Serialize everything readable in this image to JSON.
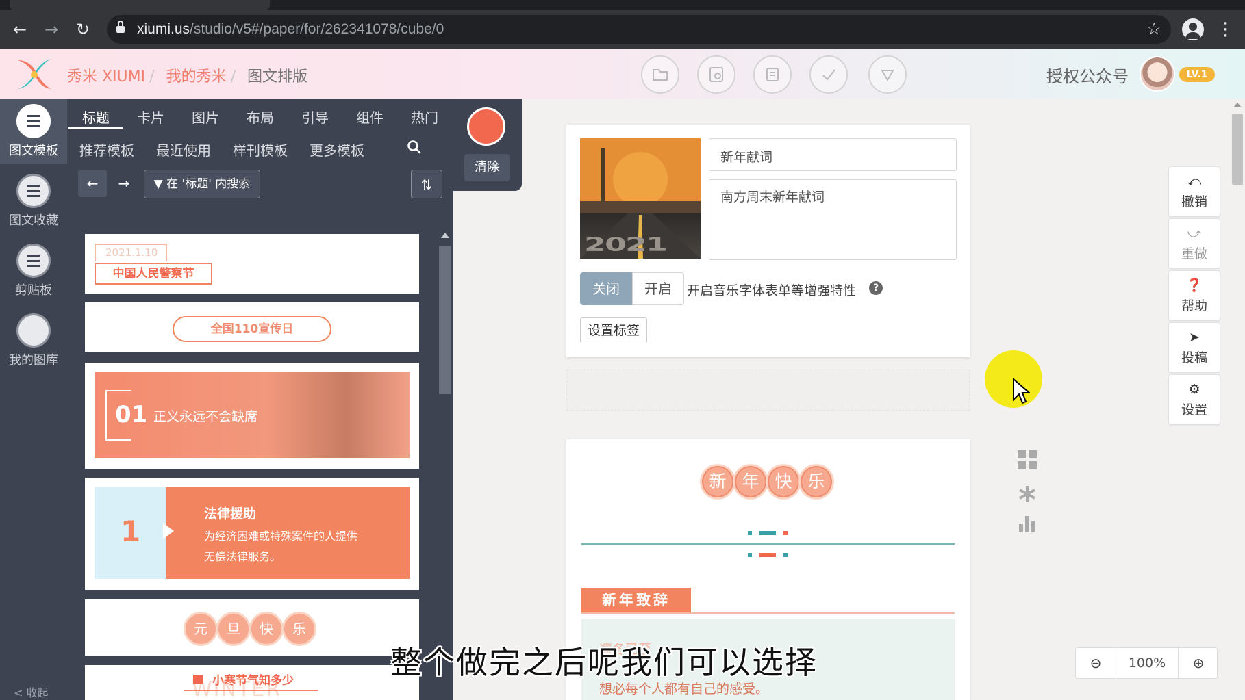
{
  "browser": {
    "url_host": "xiumi.us",
    "url_path": "/studio/v5#/paper/for/262341078/cube/0"
  },
  "header": {
    "brand": "秀米 XIUMI",
    "crumb_my": "我的秀米",
    "crumb_current": "图文排版",
    "auth_label": "授权公众号",
    "level_badge": "LV.1"
  },
  "rail": {
    "items": [
      {
        "label": "图文模板",
        "icon": "template-icon"
      },
      {
        "label": "图文收藏",
        "icon": "favorites-icon"
      },
      {
        "label": "剪贴板",
        "icon": "clipboard-icon"
      },
      {
        "label": "我的图库",
        "icon": "gallery-icon"
      }
    ],
    "collapse": "< 收起"
  },
  "panel": {
    "categories": [
      "标题",
      "卡片",
      "图片",
      "布局",
      "引导",
      "组件",
      "热门"
    ],
    "subcategories": [
      "推荐模板",
      "最近使用",
      "样刊模板",
      "更多模板"
    ],
    "filter_label": "在 '标题' 内搜索",
    "clear_label": "清除"
  },
  "templates": {
    "t1_date": "2021.1.10",
    "t1_title": "中国人民警察节",
    "t2_title": "全国110宣传日",
    "t3_num": "01",
    "t3_text": "正义永远不会缺席",
    "t4_num": "1",
    "t4_title": "法律援助",
    "t4_line1": "为经济困难或特殊案件的人提供",
    "t4_line2": "无偿法律服务。",
    "t5_chars": [
      "元",
      "旦",
      "快",
      "乐"
    ],
    "t6_title": "小寒节气知多少",
    "t6_bg": "WINTER"
  },
  "editor": {
    "cover_text": "2021",
    "title_value": "新年献词",
    "digest_value": "南方周末新年献词",
    "toggle_off": "关闭",
    "toggle_on": "开启",
    "enhance_label": "开启音乐字体表单等增强特性",
    "help": "?",
    "tag_button": "设置标签"
  },
  "doc": {
    "greeting_chars": [
      "新",
      "年",
      "快",
      "乐"
    ],
    "section_title": "新年致辞",
    "para1": "凛冬已至",
    "para2": "想必每个人都有自己的感受。"
  },
  "right_tools": [
    {
      "label": "撤销",
      "icon": "undo-icon"
    },
    {
      "label": "重做",
      "icon": "redo-icon"
    },
    {
      "label": "帮助",
      "icon": "help-icon"
    },
    {
      "label": "投稿",
      "icon": "send-icon"
    },
    {
      "label": "设置",
      "icon": "gear-icon"
    }
  ],
  "zoom": {
    "value": "100%"
  },
  "caption": "整个做完之后呢我们可以选择",
  "colors": {
    "accent": "#f2684f",
    "panel": "#3d4350",
    "toggle_active": "#8fa6b8",
    "highlight": "#f4ea1a"
  }
}
